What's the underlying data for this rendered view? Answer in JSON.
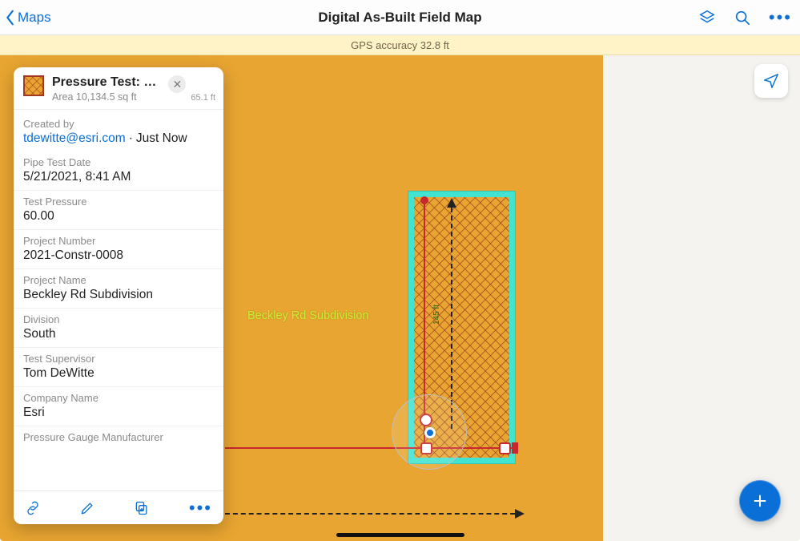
{
  "header": {
    "back_label": "Maps",
    "title": "Digital As-Built Field Map"
  },
  "gps": {
    "text": "GPS accuracy 32.8 ft"
  },
  "map": {
    "subdivision_label": "Beckley Rd Subdivision",
    "measurement_label": "145 ft"
  },
  "popup": {
    "title": "Pressure Test: Beckley R…",
    "area": "Area 10,134.5 sq ft",
    "distance": "65.1 ft",
    "created_by_label": "Created by",
    "creator_email": "tdewitte@esri.com",
    "created_when": "Just Now",
    "fields": [
      {
        "label": "Pipe Test Date",
        "value": "5/21/2021, 8:41 AM"
      },
      {
        "label": "Test Pressure",
        "value": "60.00"
      },
      {
        "label": "Project Number",
        "value": "2021-Constr-0008"
      },
      {
        "label": "Project Name",
        "value": "Beckley Rd Subdivision"
      },
      {
        "label": "Division",
        "value": "South"
      },
      {
        "label": "Test Supervisor",
        "value": "Tom DeWitte"
      },
      {
        "label": "Company Name",
        "value": "Esri"
      },
      {
        "label": "Pressure Gauge Manufacturer",
        "value": ""
      }
    ]
  },
  "icons": {
    "layers": "layers",
    "search": "search",
    "more": "more",
    "locate": "locate",
    "link": "link",
    "edit": "edit",
    "copy": "copy",
    "add": "add"
  }
}
